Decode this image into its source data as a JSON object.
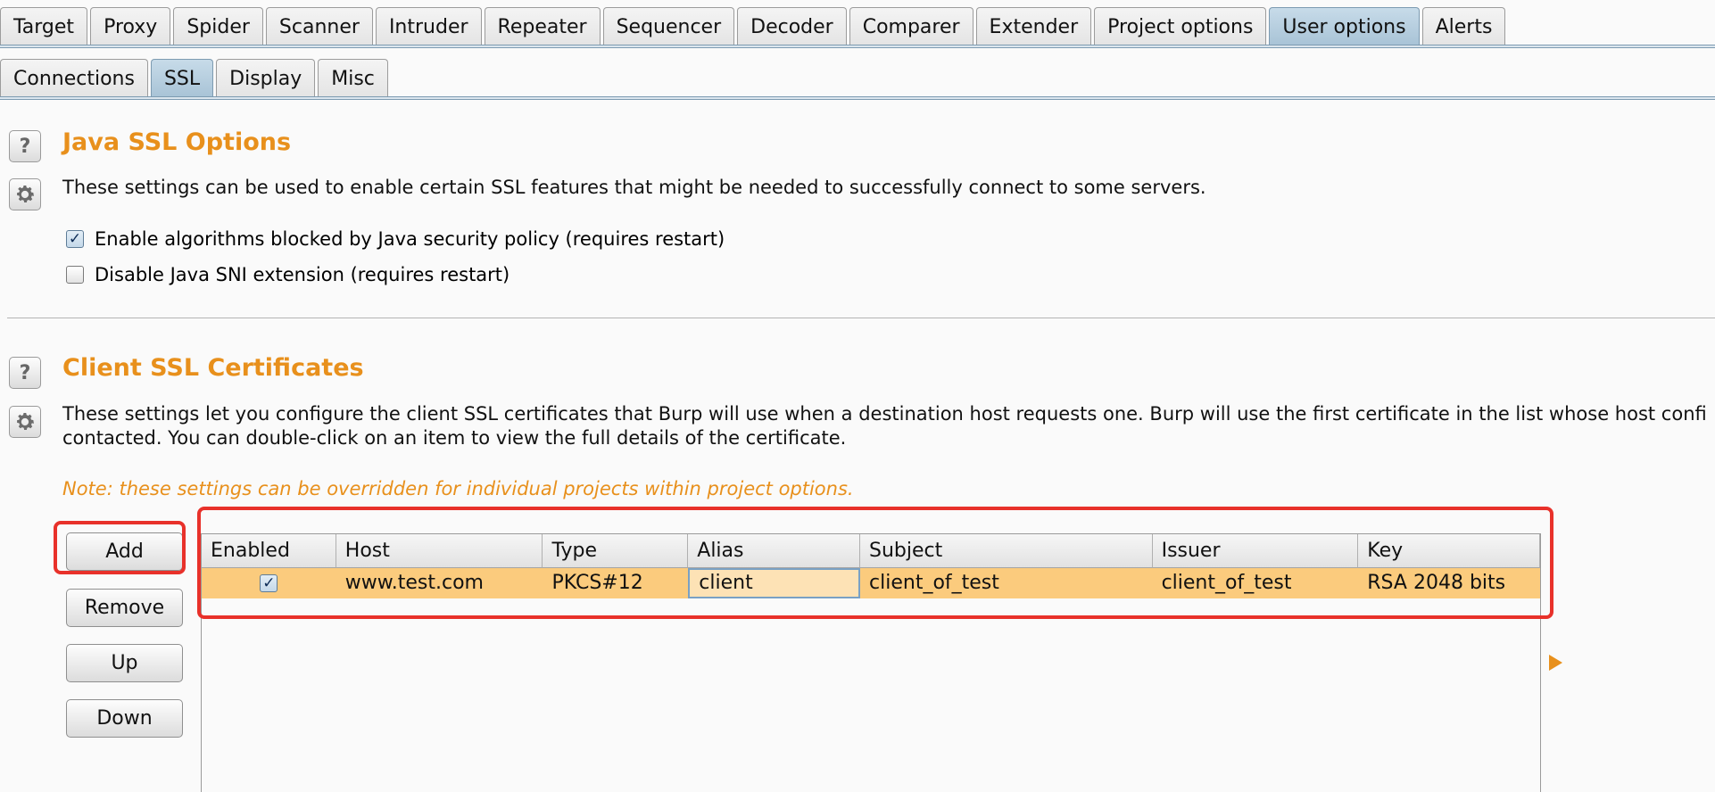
{
  "main_tabs": [
    "Target",
    "Proxy",
    "Spider",
    "Scanner",
    "Intruder",
    "Repeater",
    "Sequencer",
    "Decoder",
    "Comparer",
    "Extender",
    "Project options",
    "User options",
    "Alerts"
  ],
  "main_tab_active": "User options",
  "sub_tabs": [
    "Connections",
    "SSL",
    "Display",
    "Misc"
  ],
  "sub_tab_active": "SSL",
  "java_ssl": {
    "title": "Java SSL Options",
    "description": "These settings can be used to enable certain SSL features that might be needed to successfully connect to some servers.",
    "options": [
      {
        "label": "Enable algorithms blocked by Java security policy (requires restart)",
        "checked": true
      },
      {
        "label": "Disable Java SNI extension (requires restart)",
        "checked": false
      }
    ]
  },
  "client_ssl": {
    "title": "Client SSL Certificates",
    "description_line1": "These settings let you configure the client SSL certificates that Burp will use when a destination host requests one. Burp will use the first certificate in the list whose host confi",
    "description_line2": "contacted. You can double-click on an item to view the full details of the certificate.",
    "note": "Note: these settings can be overridden for individual projects within project options.",
    "buttons": {
      "add": "Add",
      "remove": "Remove",
      "up": "Up",
      "down": "Down"
    },
    "table": {
      "columns": [
        "Enabled",
        "Host",
        "Type",
        "Alias",
        "Subject",
        "Issuer",
        "Key"
      ],
      "rows": [
        {
          "enabled": true,
          "host": "www.test.com",
          "type": "PKCS#12",
          "alias": "client",
          "subject": "client_of_test",
          "issuer": "client_of_test",
          "key": "RSA 2048 bits"
        }
      ]
    }
  },
  "colors": {
    "accent_orange": "#e8901c",
    "selected_row": "#fbcb7d",
    "annotation_red": "#e8312a",
    "active_tab": "#a8c3d6"
  },
  "icons": {
    "help": "question-mark-icon",
    "settings": "gear-icon",
    "expand": "play-triangle-icon"
  }
}
